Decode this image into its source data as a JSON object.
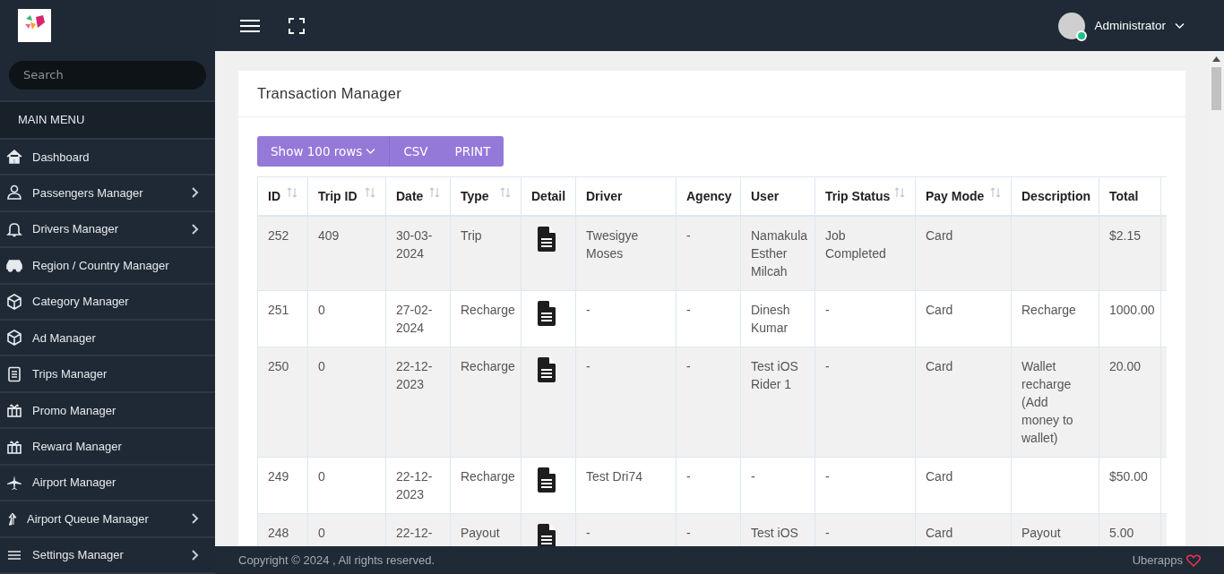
{
  "sidebar": {
    "search": {
      "placeholder": "Search"
    },
    "menu_title": "MAIN MENU",
    "items": [
      {
        "label": "Dashboard",
        "has_submenu": false
      },
      {
        "label": "Passengers Manager",
        "has_submenu": true
      },
      {
        "label": "Drivers Manager",
        "has_submenu": true
      },
      {
        "label": "Region / Country Manager",
        "has_submenu": false
      },
      {
        "label": "Category Manager",
        "has_submenu": false
      },
      {
        "label": "Ad Manager",
        "has_submenu": false
      },
      {
        "label": "Trips Manager",
        "has_submenu": false
      },
      {
        "label": "Promo Manager",
        "has_submenu": false
      },
      {
        "label": "Reward Manager",
        "has_submenu": false
      },
      {
        "label": "Airport Manager",
        "has_submenu": false
      },
      {
        "label": "Airport Queue Manager",
        "has_submenu": true
      },
      {
        "label": "Settings Manager",
        "has_submenu": true
      }
    ]
  },
  "topbar": {
    "user": "Administrator",
    "online": true
  },
  "card": {
    "title": "Transaction Manager",
    "buttons": [
      "Show 100 rows",
      "CSV",
      "PRINT"
    ],
    "table": {
      "columns": [
        {
          "label": "ID",
          "sortable": true
        },
        {
          "label": "Trip ID",
          "sortable": true
        },
        {
          "label": "Date",
          "sortable": true
        },
        {
          "label": "Type",
          "sortable": true
        },
        {
          "label": "Detail",
          "sortable": false
        },
        {
          "label": "Driver",
          "sortable": false
        },
        {
          "label": "Agency",
          "sortable": false
        },
        {
          "label": "User",
          "sortable": false
        },
        {
          "label": "Trip Status",
          "sortable": true
        },
        {
          "label": "Pay Mode",
          "sortable": true
        },
        {
          "label": "Description",
          "sortable": false
        },
        {
          "label": "Total",
          "sortable": false
        }
      ],
      "rows": [
        {
          "id": "252",
          "trip_id": "409",
          "date": "30-03-2024",
          "type": "Trip",
          "driver": "Twesigye Moses",
          "agency": "-",
          "user": "Namakula Esther Milcah",
          "trip_status": "Job Completed",
          "pay_mode": "Card",
          "total": "$2.15"
        },
        {
          "id": "251",
          "trip_id": "0",
          "date": "27-02-2024",
          "type": "Recharge",
          "driver": "-",
          "agency": "-",
          "user": "Dinesh Kumar",
          "trip_status": "-",
          "pay_mode": "Card",
          "description": "Recharge",
          "total": "1000.00"
        },
        {
          "id": "250",
          "trip_id": "0",
          "date": "22-12-2023",
          "type": "Recharge",
          "driver": "-",
          "agency": "-",
          "user": "Test iOS Rider 1",
          "trip_status": "-",
          "pay_mode": "Card",
          "description": "Wallet recharge (Add money to wallet)",
          "total": "20.00"
        },
        {
          "id": "249",
          "trip_id": "0",
          "date": "22-12-2023",
          "type": "Recharge",
          "driver": "Test Dri74",
          "agency": "-",
          "user": "-",
          "trip_status": "-",
          "pay_mode": "Card",
          "total": "$50.00"
        },
        {
          "id": "248",
          "trip_id": "0",
          "date": "22-12-",
          "type": "Payout",
          "driver": "-",
          "agency": "-",
          "user": "Test iOS",
          "trip_status": "-",
          "pay_mode": "Card",
          "description": "Payout",
          "total": "5.00"
        }
      ]
    }
  },
  "footer": {
    "copyright": "Copyright © 2024 , All rights reserved.",
    "brand": "Uberapps"
  }
}
